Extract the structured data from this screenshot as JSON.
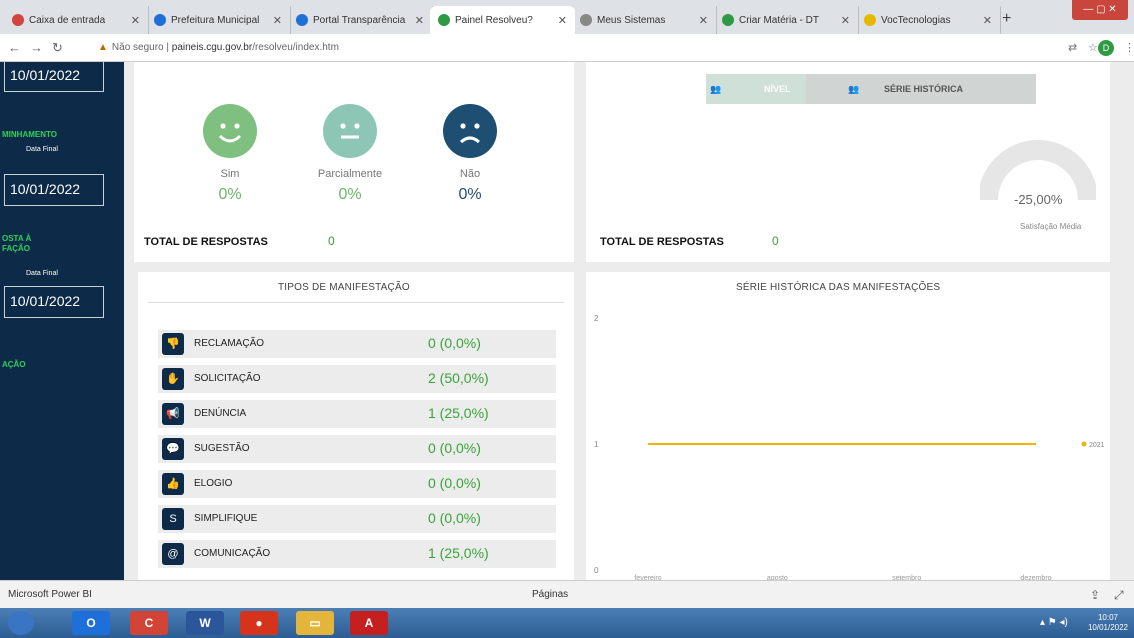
{
  "browser": {
    "tabs": [
      {
        "label": "Caixa de entrada",
        "color": "#d1443f"
      },
      {
        "label": "Prefeitura Municipal",
        "color": "#1e6fd9"
      },
      {
        "label": "Portal Transparência",
        "color": "#1e6fd9"
      },
      {
        "label": "Painel Resolveu?",
        "color": "#2e9b44",
        "active": true
      },
      {
        "label": "Meus Sistemas",
        "color": "#888888"
      },
      {
        "label": "Criar Matéria - DT",
        "color": "#2e9b44"
      },
      {
        "label": "VocTecnologias",
        "color": "#e6b800"
      }
    ],
    "url_warning": "Não seguro",
    "url_host": "paineis.cgu.gov.br",
    "url_path": "/resolveu/index.htm",
    "profile_initial": "D"
  },
  "sidebar": {
    "date_top": "10/01/2022",
    "section1": "MINHAMENTO",
    "label1": "Data Final",
    "date1": "10/01/2022",
    "section2a": "OSTA À",
    "section2b": "FAÇÃO",
    "label2": "Data Final",
    "date2": "10/01/2022",
    "section3": "AÇÃO"
  },
  "satisfaction": {
    "faces": [
      {
        "label": "Sim",
        "pct": "0%",
        "color": "#7fbf7f",
        "mood": "happy"
      },
      {
        "label": "Parcialmente",
        "pct": "0%",
        "color": "#8ec6b6",
        "mood": "neutral"
      },
      {
        "label": "Não",
        "pct": "0%",
        "color": "#1f4e73",
        "mood": "sad"
      }
    ],
    "total_label": "TOTAL DE RESPOSTAS",
    "total_value": "0"
  },
  "nivel": {
    "seg_nivel": "NÍVEL",
    "seg_serie": "SÉRIE HISTÓRICA",
    "gauge_value": "-25,00%",
    "gauge_caption": "Satisfação Média",
    "total_label": "TOTAL DE RESPOSTAS",
    "total_value": "0"
  },
  "tipos": {
    "title": "TIPOS DE MANIFESTAÇÃO",
    "rows": [
      {
        "name": "RECLAMAÇÃO",
        "value": "0 (0,0%)",
        "icon": "thumbs-down-icon",
        "glyph": "👎"
      },
      {
        "name": "SOLICITAÇÃO",
        "value": "2 (50,0%)",
        "icon": "hand-icon",
        "glyph": "✋"
      },
      {
        "name": "DENÚNCIA",
        "value": "1 (25,0%)",
        "icon": "megaphone-icon",
        "glyph": "📢"
      },
      {
        "name": "SUGESTÃO",
        "value": "0 (0,0%)",
        "icon": "chat-icon",
        "glyph": "💬"
      },
      {
        "name": "ELOGIO",
        "value": "0 (0,0%)",
        "icon": "thumbs-up-icon",
        "glyph": "👍"
      },
      {
        "name": "SIMPLIFIQUE",
        "value": "0 (0,0%)",
        "icon": "simplifique-icon",
        "glyph": "S"
      },
      {
        "name": "COMUNICAÇÃO",
        "value": "1 (25,0%)",
        "icon": "communication-icon",
        "glyph": "@"
      }
    ]
  },
  "serie": {
    "title": "SÉRIE HISTÓRICA DAS MANIFESTAÇÕES"
  },
  "chart_data": {
    "type": "line",
    "x": [
      "fevereiro",
      "agosto",
      "setembro",
      "dezembro"
    ],
    "series": [
      {
        "name": "2021",
        "values": [
          1,
          1,
          1,
          1
        ],
        "color": "#f0b400"
      }
    ],
    "yticks": [
      "0",
      "1",
      "2"
    ],
    "ylim": [
      0,
      2
    ],
    "legend": "right"
  },
  "statusbar": {
    "app": "Microsoft Power BI",
    "pages": "Páginas"
  },
  "taskbar": {
    "items": [
      {
        "name": "start-button",
        "glyph": "",
        "color": "#3a75c4"
      },
      {
        "name": "outlook-icon",
        "glyph": "O",
        "color": "#1e6fd9"
      },
      {
        "name": "chrome-icon",
        "glyph": "C",
        "color": "#d14436"
      },
      {
        "name": "word-icon",
        "glyph": "W",
        "color": "#2b579a"
      },
      {
        "name": "app-icon",
        "glyph": "●",
        "color": "#d6331c"
      },
      {
        "name": "explorer-icon",
        "glyph": "▭",
        "color": "#e3b53b"
      },
      {
        "name": "acrobat-icon",
        "glyph": "A",
        "color": "#c51f1f"
      }
    ],
    "time": "10:07",
    "date": "10/01/2022"
  }
}
